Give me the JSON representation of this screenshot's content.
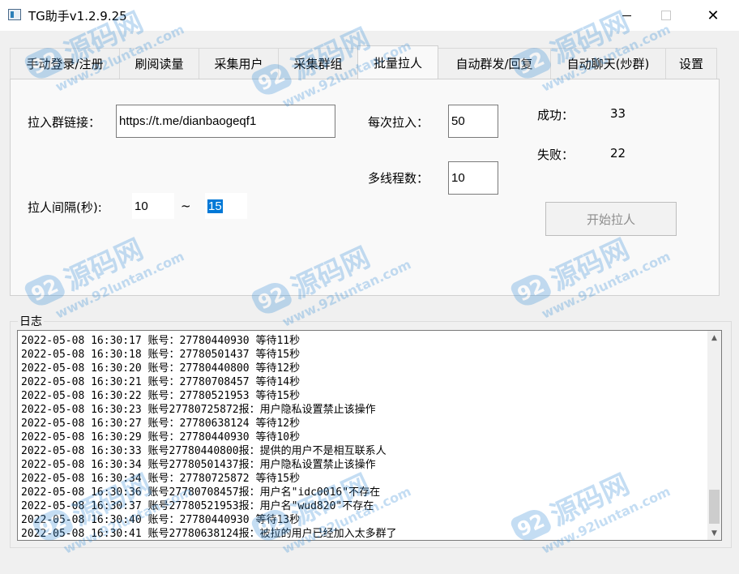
{
  "window": {
    "title": "TG助手v1.2.9.25",
    "close_glyph": "✕"
  },
  "tabs": [
    {
      "label": "手动登录/注册"
    },
    {
      "label": "刷阅读量"
    },
    {
      "label": "采集用户"
    },
    {
      "label": "采集群组"
    },
    {
      "label": "批量拉人",
      "active": true
    },
    {
      "label": "自动群发/回复"
    },
    {
      "label": "自动聊天(炒群)"
    },
    {
      "label": "设置"
    }
  ],
  "form": {
    "group_link_label": "拉入群链接：",
    "group_link_value": "https://t.me/dianbaogeqf1",
    "per_pull_label": "每次拉入：",
    "per_pull_value": "50",
    "threads_label": "多线程数：",
    "threads_value": "10",
    "interval_label": "拉人间隔(秒):",
    "interval_min": "10",
    "interval_sep": "~",
    "interval_max": "15",
    "success_label": "成功：",
    "success_value": "33",
    "fail_label": "失败：",
    "fail_value": "22",
    "start_button": "开始拉人"
  },
  "log": {
    "title": "日志",
    "lines": [
      "2022-05-08 16:30:17 账号：27780440930 等待11秒",
      "2022-05-08 16:30:18 账号：27780501437 等待15秒",
      "2022-05-08 16:30:20 账号：27780440800 等待12秒",
      "2022-05-08 16:30:21 账号：27780708457 等待14秒",
      "2022-05-08 16:30:22 账号：27780521953 等待15秒",
      "2022-05-08 16:30:23 账号27780725872报：用户隐私设置禁止该操作",
      "2022-05-08 16:30:27 账号：27780638124 等待12秒",
      "2022-05-08 16:30:29 账号：27780440930 等待10秒",
      "2022-05-08 16:30:33 账号27780440800报：提供的用户不是相互联系人",
      "2022-05-08 16:30:34 账号27780501437报：用户隐私设置禁止该操作",
      "2022-05-08 16:30:34 账号：27780725872 等待15秒",
      "2022-05-08 16:30:36 账号27780708457报：用户名\"idc0016\"不存在",
      "2022-05-08 16:30:37 账号27780521953报：用户名\"wud820\"不存在",
      "2022-05-08 16:30:40 账号：27780440930 等待13秒",
      "2022-05-08 16:30:41 账号27780638124报：被拉的用户已经加入太多群了"
    ]
  },
  "watermark": {
    "badge": "92",
    "text": "源码网",
    "url": "www.92luntan.com"
  }
}
